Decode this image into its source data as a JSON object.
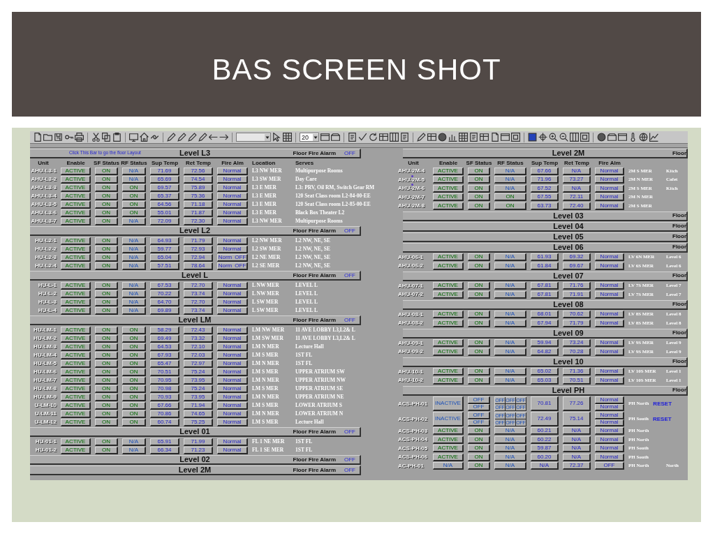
{
  "slide": {
    "title": "BAS SCREEN SHOT"
  },
  "toolbar": {
    "dropdown_value": "20"
  },
  "left_panel": {
    "levels": [
      {
        "title": "Level L3",
        "hint": "Click This Bar to go the floor Layout",
        "alarm_label": "Floor Fire Alarm",
        "alarm_state": "OFF",
        "columns": [
          "Unit",
          "Enable",
          "SF Status",
          "RF Status",
          "Sup Temp",
          "Ret Temp",
          "Fire Alm",
          "Location",
          "Serves"
        ],
        "rows": [
          {
            "kind": "single",
            "unit": "AHU-L3-1",
            "enable": "ACTIVE",
            "enable_on": true,
            "sf_status": "ON",
            "sf_on": true,
            "rf_status": "N/A",
            "rf_on": false,
            "sup_temp": "71.69",
            "ret_temp": "72.56",
            "fire_alm": [
              "Normal"
            ],
            "location": "L3 NW MER",
            "serves": "Multipurpose Rooms"
          },
          {
            "kind": "single",
            "unit": "AHU-L3-2",
            "enable": "ACTIVE",
            "enable_on": true,
            "sf_status": "ON",
            "sf_on": true,
            "rf_status": "N/A",
            "rf_on": false,
            "sup_temp": "65.69",
            "ret_temp": "74.54",
            "fire_alm": [
              "Normal"
            ],
            "location": "L3 SW MER",
            "serves": "Day Care"
          },
          {
            "kind": "single",
            "unit": "AHU-L3-3",
            "enable": "ACTIVE",
            "enable_on": true,
            "sf_status": "ON",
            "sf_on": true,
            "rf_status": "ON",
            "rf_on": true,
            "sup_temp": "69.57",
            "ret_temp": "75.89",
            "fire_alm": [
              "Normal"
            ],
            "location": "L3 E MER",
            "serves": "L3: PRV, Oil RM, Switch Gear RM"
          },
          {
            "kind": "single",
            "unit": "AHU-L3-4",
            "enable": "ACTIVE",
            "enable_on": true,
            "sf_status": "ON",
            "sf_on": true,
            "rf_status": "ON",
            "rf_on": true,
            "sup_temp": "65.37",
            "ret_temp": "75.36",
            "fire_alm": [
              "Normal"
            ],
            "location": "L3 E MER",
            "serves": "120 Seat Class room L2-84-00-EE"
          },
          {
            "kind": "single",
            "unit": "AHU-L3-5",
            "enable": "ACTIVE",
            "enable_on": true,
            "sf_status": "ON",
            "sf_on": true,
            "rf_status": "ON",
            "rf_on": true,
            "sup_temp": "64.56",
            "ret_temp": "71.18",
            "fire_alm": [
              "Normal"
            ],
            "location": "L3 E MER",
            "serves": "120 Seat Class room L2-85-00-EE"
          },
          {
            "kind": "single",
            "unit": "AHU-L3-6",
            "enable": "ACTIVE",
            "enable_on": true,
            "sf_status": "ON",
            "sf_on": true,
            "rf_status": "ON",
            "rf_on": true,
            "sup_temp": "55.01",
            "ret_temp": "71.87",
            "fire_alm": [
              "Normal"
            ],
            "location": "L3 E MER",
            "serves": "Black Box Theater L2"
          },
          {
            "kind": "single",
            "unit": "AHU-L3-7",
            "enable": "ACTIVE",
            "enable_on": true,
            "sf_status": "ON",
            "sf_on": true,
            "rf_status": "N/A",
            "rf_on": false,
            "sup_temp": "72.09",
            "ret_temp": "72.30",
            "fire_alm": [
              "Normal"
            ],
            "location": "L3 NW MER",
            "serves": "Multipurpose Rooms"
          }
        ]
      },
      {
        "title": "Level L2",
        "alarm_label": "Floor Fire Alarm",
        "alarm_state": "OFF",
        "rows": [
          {
            "kind": "single",
            "unit": "HU-L2-1",
            "enable": "ACTIVE",
            "enable_on": true,
            "sf_status": "ON",
            "sf_on": true,
            "rf_status": "N/A",
            "rf_on": false,
            "sup_temp": "64.93",
            "ret_temp": "71.79",
            "fire_alm": [
              "Normal"
            ],
            "location": "L2 NW MER",
            "serves": "L2 NW, NE, SE"
          },
          {
            "kind": "single",
            "unit": "HU-L2-2",
            "enable": "ACTIVE",
            "enable_on": true,
            "sf_status": "ON",
            "sf_on": true,
            "rf_status": "N/A",
            "rf_on": false,
            "sup_temp": "59.77",
            "ret_temp": "72.93",
            "fire_alm": [
              "Normal"
            ],
            "location": "L2 SW MER",
            "serves": "L2 NW, NE, SE"
          },
          {
            "kind": "single",
            "unit": "HU-L2-3",
            "enable": "ACTIVE",
            "enable_on": true,
            "sf_status": "ON",
            "sf_on": true,
            "rf_status": "N/A",
            "rf_on": false,
            "sup_temp": "65.04",
            "ret_temp": "72.94",
            "fire_alm": [
              "Norm",
              "OFF"
            ],
            "location": "L2 NE MER",
            "serves": "L2 NW, NE, SE"
          },
          {
            "kind": "single",
            "unit": "HU-L2-4",
            "enable": "ACTIVE",
            "enable_on": true,
            "sf_status": "ON",
            "sf_on": true,
            "rf_status": "N/A",
            "rf_on": false,
            "sup_temp": "57.51",
            "ret_temp": "78.64",
            "fire_alm": [
              "Norm",
              "OFF"
            ],
            "location": "L2 SE MER",
            "serves": "L2 NW, NE, SE"
          }
        ]
      },
      {
        "title": "Level L",
        "alarm_label": "Floor Fire Alarm",
        "alarm_state": "OFF",
        "rows": [
          {
            "kind": "single",
            "unit": "HU-L-1",
            "enable": "ACTIVE",
            "enable_on": true,
            "sf_status": "ON",
            "sf_on": true,
            "rf_status": "N/A",
            "rf_on": false,
            "sup_temp": "67.53",
            "ret_temp": "72.70",
            "fire_alm": [
              "Normal"
            ],
            "location": "L NW MER",
            "serves": "LEVEL L"
          },
          {
            "kind": "single",
            "unit": "HU-L-2",
            "enable": "ACTIVE",
            "enable_on": true,
            "sf_status": "ON",
            "sf_on": true,
            "rf_status": "N/A",
            "rf_on": false,
            "sup_temp": "70.22",
            "ret_temp": "73.74",
            "fire_alm": [
              "Normal"
            ],
            "location": "L NW MER",
            "serves": "LEVEL L"
          },
          {
            "kind": "single",
            "unit": "HU-L-3",
            "enable": "ACTIVE",
            "enable_on": true,
            "sf_status": "ON",
            "sf_on": true,
            "rf_status": "N/A",
            "rf_on": false,
            "sup_temp": "64.70",
            "ret_temp": "72.70",
            "fire_alm": [
              "Normal"
            ],
            "location": "L SW MER",
            "serves": "LEVEL L"
          },
          {
            "kind": "single",
            "unit": "HU-L-4",
            "enable": "ACTIVE",
            "enable_on": true,
            "sf_status": "ON",
            "sf_on": true,
            "rf_status": "N/A",
            "rf_on": false,
            "sup_temp": "69.89",
            "ret_temp": "73.74",
            "fire_alm": [
              "Normal"
            ],
            "location": "L SW MER",
            "serves": "LEVEL L"
          }
        ]
      },
      {
        "title": "Level LM",
        "alarm_label": "Floor Fire Alarm",
        "alarm_state": "OFF",
        "rows": [
          {
            "kind": "single",
            "unit": "HU-LM-1",
            "enable": "ACTIVE",
            "enable_on": true,
            "sf_status": "ON",
            "sf_on": true,
            "rf_status": "ON",
            "rf_on": true,
            "sup_temp": "58.29",
            "ret_temp": "72.43",
            "fire_alm": [
              "Normal"
            ],
            "location": "LM NW MER",
            "serves": "11 AVE LOBBY L3,L2& L"
          },
          {
            "kind": "single",
            "unit": "HU-LM-2",
            "enable": "ACTIVE",
            "enable_on": true,
            "sf_status": "ON",
            "sf_on": true,
            "rf_status": "ON",
            "rf_on": true,
            "sup_temp": "69.49",
            "ret_temp": "73.32",
            "fire_alm": [
              "Normal"
            ],
            "location": "LM SW MER",
            "serves": "11 AVE LOBBY L3,L2& L"
          },
          {
            "kind": "single",
            "unit": "HU-LM-3",
            "enable": "ACTIVE",
            "enable_on": true,
            "sf_status": "ON",
            "sf_on": true,
            "rf_status": "ON",
            "rf_on": true,
            "sup_temp": "64.53",
            "ret_temp": "72.10",
            "fire_alm": [
              "Normal"
            ],
            "location": "LM N MER",
            "serves": "Lecture Hall"
          },
          {
            "kind": "single",
            "unit": "HU-LM-4",
            "enable": "ACTIVE",
            "enable_on": true,
            "sf_status": "ON",
            "sf_on": true,
            "rf_status": "ON",
            "rf_on": true,
            "sup_temp": "67.93",
            "ret_temp": "72.03",
            "fire_alm": [
              "Normal"
            ],
            "location": "LM S MER",
            "serves": "1ST FL"
          },
          {
            "kind": "single",
            "unit": "HU-LM-5",
            "enable": "ACTIVE",
            "enable_on": true,
            "sf_status": "ON",
            "sf_on": true,
            "rf_status": "ON",
            "rf_on": true,
            "sup_temp": "65.47",
            "ret_temp": "72.97",
            "fire_alm": [
              "Normal"
            ],
            "location": "LM N MER",
            "serves": "1ST FL"
          },
          {
            "kind": "single",
            "unit": "HU-LM-6",
            "enable": "ACTIVE",
            "enable_on": true,
            "sf_status": "ON",
            "sf_on": true,
            "rf_status": "ON",
            "rf_on": true,
            "sup_temp": "70.51",
            "ret_temp": "75.24",
            "fire_alm": [
              "Normal"
            ],
            "location": "LM S MER",
            "serves": "UPPER ATRIUM SW"
          },
          {
            "kind": "single",
            "unit": "HU-LM-7",
            "enable": "ACTIVE",
            "enable_on": true,
            "sf_status": "ON",
            "sf_on": true,
            "rf_status": "ON",
            "rf_on": true,
            "sup_temp": "70.95",
            "ret_temp": "73.95",
            "fire_alm": [
              "Normal"
            ],
            "location": "LM N MER",
            "serves": "UPPER ATRIUM NW"
          },
          {
            "kind": "single",
            "unit": "HU-LM-8",
            "enable": "ACTIVE",
            "enable_on": true,
            "sf_status": "ON",
            "sf_on": true,
            "rf_status": "ON",
            "rf_on": true,
            "sup_temp": "70.98",
            "ret_temp": "75.24",
            "fire_alm": [
              "Normal"
            ],
            "location": "LM S MER",
            "serves": "UPPER ATRIUM SE"
          },
          {
            "kind": "single",
            "unit": "HU-LM-9",
            "enable": "ACTIVE",
            "enable_on": true,
            "sf_status": "ON",
            "sf_on": true,
            "rf_status": "ON",
            "rf_on": true,
            "sup_temp": "70.93",
            "ret_temp": "73.95",
            "fire_alm": [
              "Normal"
            ],
            "location": "LM N MER",
            "serves": "UPPER ATRIUM NE"
          },
          {
            "kind": "single",
            "unit": "U-LM-10",
            "enable": "ACTIVE",
            "enable_on": true,
            "sf_status": "ON",
            "sf_on": true,
            "rf_status": "ON",
            "rf_on": true,
            "sup_temp": "67.66",
            "ret_temp": "71.94",
            "fire_alm": [
              "Normal"
            ],
            "location": "LM S MER",
            "serves": "LOWER ATRIUM S"
          },
          {
            "kind": "single",
            "unit": "U-LM-11",
            "enable": "ACTIVE",
            "enable_on": true,
            "sf_status": "ON",
            "sf_on": true,
            "rf_status": "ON",
            "rf_on": true,
            "sup_temp": "70.86",
            "ret_temp": "74.65",
            "fire_alm": [
              "Normal"
            ],
            "location": "LM N MER",
            "serves": "LOWER ATRIUM N"
          },
          {
            "kind": "single",
            "unit": "U-LM-12",
            "enable": "ACTIVE",
            "enable_on": true,
            "sf_status": "ON",
            "sf_on": true,
            "rf_status": "ON",
            "rf_on": true,
            "sup_temp": "60.74",
            "ret_temp": "75.25",
            "fire_alm": [
              "Normal"
            ],
            "location": "LM S MER",
            "serves": "Lecture Hall"
          }
        ]
      },
      {
        "title": "Level 01",
        "alarm_label": "Floor Fire Alarm",
        "alarm_state": "OFF",
        "rows": [
          {
            "kind": "single",
            "unit": "HU-01-1",
            "enable": "ACTIVE",
            "enable_on": true,
            "sf_status": "ON",
            "sf_on": true,
            "rf_status": "N/A",
            "rf_on": false,
            "sup_temp": "65.91",
            "ret_temp": "71.99",
            "fire_alm": [
              "Normal"
            ],
            "location": "FL 1 NE MER",
            "serves": "1ST FL"
          },
          {
            "kind": "single",
            "unit": "HU-01-2",
            "enable": "ACTIVE",
            "enable_on": true,
            "sf_status": "ON",
            "sf_on": true,
            "rf_status": "N/A",
            "rf_on": false,
            "sup_temp": "66.34",
            "ret_temp": "71.23",
            "fire_alm": [
              "Normal"
            ],
            "location": "FL 1 SE MER",
            "serves": "1ST FL"
          }
        ]
      },
      {
        "title": "Level 02",
        "alarm_label": "Floor Fire Alarm",
        "alarm_state": "OFF"
      },
      {
        "title": "Level 2M",
        "alarm_label": "Floor Fire Alarm",
        "alarm_state": "OFF"
      }
    ]
  },
  "right_panel": {
    "levels": [
      {
        "title": "Level 2M",
        "alarm_label": "Floor",
        "columns": [
          "Unit",
          "Enable",
          "SF Status",
          "RF Status",
          "Sup Temp",
          "Ret Temp",
          "Fire Alm"
        ],
        "rows": [
          {
            "kind": "single",
            "unit": "AHU-2M-4",
            "marked": false,
            "enable": "ACTIVE",
            "enable_on": true,
            "sf_status": "ON",
            "sf_on": true,
            "rf_status": "N/A",
            "rf_on": false,
            "sup_temp": "67.66",
            "ret_temp": "N/A",
            "fire_alm": [
              "Normal"
            ],
            "location": "2M S MER",
            "serves": "Kitch"
          },
          {
            "kind": "single",
            "unit": "AHU-2M-5",
            "marked": true,
            "enable": "ACTIVE",
            "enable_on": true,
            "sf_status": "ON",
            "sf_on": true,
            "rf_status": "N/A",
            "rf_on": false,
            "sup_temp": "71.96",
            "ret_temp": "73.27",
            "fire_alm": [
              "Normal"
            ],
            "location": "2M N MER",
            "serves": "Cafet"
          },
          {
            "kind": "single",
            "unit": "AHU-2M-6",
            "marked": true,
            "enable": "ACTIVE",
            "enable_on": true,
            "sf_status": "ON",
            "sf_on": true,
            "rf_status": "N/A",
            "rf_on": false,
            "sup_temp": "67.52",
            "ret_temp": "N/A",
            "fire_alm": [
              "Normal"
            ],
            "location": "2M S MER",
            "serves": "Kitch"
          },
          {
            "kind": "single",
            "unit": "AHU-2M-7",
            "marked": false,
            "enable": "ACTIVE",
            "enable_on": true,
            "sf_status": "ON",
            "sf_on": true,
            "rf_status": "ON",
            "rf_on": true,
            "sup_temp": "67.55",
            "ret_temp": "72.11",
            "fire_alm": [
              "Normal"
            ],
            "location": "2M N MER"
          },
          {
            "kind": "single",
            "unit": "AHU-2M-8",
            "marked": false,
            "enable": "ACTIVE",
            "enable_on": true,
            "sf_status": "ON",
            "sf_on": true,
            "rf_status": "ON",
            "rf_on": true,
            "sup_temp": "63.73",
            "ret_temp": "72.40",
            "fire_alm": [
              "Normal"
            ],
            "location": "2M S MER"
          }
        ]
      },
      {
        "title": "Level 03",
        "alarm_label": "Floor"
      },
      {
        "title": "Level 04",
        "alarm_label": "Floor"
      },
      {
        "title": "Level 05",
        "alarm_label": "Floor"
      },
      {
        "title": "Level 06",
        "alarm_label": "Floor",
        "rows": [
          {
            "kind": "single",
            "unit": "AHU-06-1",
            "enable": "ACTIVE",
            "enable_on": true,
            "sf_status": "ON",
            "sf_on": true,
            "rf_status": "N/A",
            "rf_on": false,
            "sup_temp": "61.93",
            "ret_temp": "69.32",
            "fire_alm": [
              "Normal"
            ],
            "location": "LV 6N MER",
            "serves": "Level 6"
          },
          {
            "kind": "single",
            "unit": "AHU-06-2",
            "enable": "ACTIVE",
            "enable_on": true,
            "sf_status": "ON",
            "sf_on": true,
            "rf_status": "N/A",
            "rf_on": false,
            "sup_temp": "61.84",
            "ret_temp": "69.67",
            "fire_alm": [
              "Normal"
            ],
            "location": "LV 6S MER",
            "serves": "Level 6"
          }
        ]
      },
      {
        "title": "Level 07",
        "alarm_label": "Floor",
        "rows": [
          {
            "kind": "single",
            "unit": "AHU-07-1",
            "enable": "ACTIVE",
            "enable_on": true,
            "sf_status": "ON",
            "sf_on": true,
            "rf_status": "N/A",
            "rf_on": false,
            "sup_temp": "67.81",
            "ret_temp": "71.76",
            "fire_alm": [
              "Normal"
            ],
            "location": "LV 7S MER",
            "serves": "Level 7"
          },
          {
            "kind": "single",
            "unit": "AHU-07-2",
            "enable": "ACTIVE",
            "enable_on": true,
            "sf_status": "ON",
            "sf_on": true,
            "rf_status": "N/A",
            "rf_on": false,
            "sup_temp": "67.81",
            "ret_temp": "71.91",
            "fire_alm": [
              "Normal"
            ],
            "location": "LV 7S MER",
            "serves": "Level 7"
          }
        ]
      },
      {
        "title": "Level 08",
        "alarm_label": "Floor",
        "rows": [
          {
            "kind": "single",
            "unit": "AHU-08-1",
            "enable": "ACTIVE",
            "enable_on": true,
            "sf_status": "ON",
            "sf_on": true,
            "rf_status": "N/A",
            "rf_on": false,
            "sup_temp": "68.01",
            "ret_temp": "70.62",
            "fire_alm": [
              "Normal"
            ],
            "location": "LV 8S MER",
            "serves": "Level 8"
          },
          {
            "kind": "single",
            "unit": "AHU-08-2",
            "enable": "ACTIVE",
            "enable_on": true,
            "sf_status": "ON",
            "sf_on": true,
            "rf_status": "N/A",
            "rf_on": false,
            "sup_temp": "67.94",
            "ret_temp": "71.79",
            "fire_alm": [
              "Normal"
            ],
            "location": "LV 8S MER",
            "serves": "Level 8"
          }
        ]
      },
      {
        "title": "Level 09",
        "alarm_label": "Floor",
        "rows": [
          {
            "kind": "single",
            "unit": "AHU-09-1",
            "enable": "ACTIVE",
            "enable_on": true,
            "sf_status": "ON",
            "sf_on": true,
            "rf_status": "N/A",
            "rf_on": false,
            "sup_temp": "59.94",
            "ret_temp": "73.24",
            "fire_alm": [
              "Normal"
            ],
            "location": "LV 9S MER",
            "serves": "Level 9"
          },
          {
            "kind": "single",
            "unit": "AHU-09-2",
            "enable": "ACTIVE",
            "enable_on": true,
            "sf_status": "ON",
            "sf_on": true,
            "rf_status": "N/A",
            "rf_on": false,
            "sup_temp": "64.82",
            "ret_temp": "70.28",
            "fire_alm": [
              "Normal"
            ],
            "location": "LV 9S MER",
            "serves": "Level 9"
          }
        ]
      },
      {
        "title": "Level 10",
        "alarm_label": "Floor",
        "rows": [
          {
            "kind": "single",
            "unit": "AHU-10-1",
            "enable": "ACTIVE",
            "enable_on": true,
            "sf_status": "ON",
            "sf_on": true,
            "rf_status": "N/A",
            "rf_on": false,
            "sup_temp": "65.02",
            "ret_temp": "71.36",
            "fire_alm": [
              "Normal"
            ],
            "location": "LV 10S MER",
            "serves": "Level 1"
          },
          {
            "kind": "single",
            "unit": "AHU-10-2",
            "enable": "ACTIVE",
            "enable_on": true,
            "sf_status": "ON",
            "sf_on": true,
            "rf_status": "N/A",
            "rf_on": false,
            "sup_temp": "65.03",
            "ret_temp": "70.51",
            "fire_alm": [
              "Normal"
            ],
            "location": "LV 10S MER",
            "serves": "Level 1"
          }
        ]
      },
      {
        "title": "Level PH",
        "alarm_label": "Floor",
        "rows": [
          {
            "kind": "double",
            "unit": "ACS-PH-01",
            "enable": "INACTIVE",
            "enable_on": false,
            "sf_status": [
              "OFF",
              "OFF"
            ],
            "sf_on": false,
            "rf_status": [
              [
                "OFF",
                "OFF",
                "OFF"
              ],
              [
                "OFF",
                "OFF",
                "OFF"
              ]
            ],
            "rf_on": false,
            "sup_temp": "70.81",
            "ret_temp": "77.26",
            "fire_alm": [
              "Normal",
              "Normal"
            ],
            "location": "PH North",
            "reset": "RESET"
          },
          {
            "kind": "double",
            "unit": "ACS-PH-02",
            "enable": "INACTIVE",
            "enable_on": false,
            "sf_status": [
              "OFF",
              "OFF"
            ],
            "sf_on": false,
            "rf_status": [
              [
                "OFF",
                "OFF",
                "OFF"
              ],
              [
                "OFF",
                "OFF",
                "OFF"
              ]
            ],
            "rf_on": false,
            "sup_temp": "72.49",
            "ret_temp": "75.14",
            "fire_alm": [
              "Normal",
              "Normal"
            ],
            "location": "PH South",
            "reset": "RESET"
          },
          {
            "kind": "single",
            "unit": "ACS-PH-03",
            "enable": "ACTIVE",
            "enable_on": true,
            "sf_status": "ON",
            "sf_on": true,
            "rf_status": "N/A",
            "rf_on": false,
            "sup_temp": "60.21",
            "ret_temp": "N/A",
            "fire_alm": [
              "Normal"
            ],
            "location": "PH North"
          },
          {
            "kind": "single",
            "unit": "ACS-PH-04",
            "enable": "ACTIVE",
            "enable_on": true,
            "sf_status": "ON",
            "sf_on": true,
            "rf_status": "N/A",
            "rf_on": false,
            "sup_temp": "60.22",
            "ret_temp": "N/A",
            "fire_alm": [
              "Normal"
            ],
            "location": "PH North"
          },
          {
            "kind": "single",
            "unit": "ACS-PH-05",
            "enable": "ACTIVE",
            "enable_on": true,
            "sf_status": "ON",
            "sf_on": true,
            "rf_status": "N/A",
            "rf_on": false,
            "sup_temp": "59.87",
            "ret_temp": "N/A",
            "fire_alm": [
              "Normal"
            ],
            "location": "PH South"
          },
          {
            "kind": "single",
            "unit": "ACS-PH-06",
            "enable": "ACTIVE",
            "enable_on": true,
            "sf_status": "ON",
            "sf_on": true,
            "rf_status": "N/A",
            "rf_on": false,
            "sup_temp": "60.20",
            "ret_temp": "N/A",
            "fire_alm": [
              "Normal"
            ],
            "location": "PH South"
          },
          {
            "kind": "single",
            "unit": "AC-PH-01",
            "enable": "N/A",
            "enable_on": false,
            "sf_status": "ON",
            "sf_on": true,
            "rf_status": "N/A",
            "rf_on": false,
            "sup_temp": "N/A",
            "ret_temp": "72.37",
            "fire_alm": [
              "OFF"
            ],
            "location": "PH North",
            "serves": "North"
          }
        ]
      }
    ]
  }
}
